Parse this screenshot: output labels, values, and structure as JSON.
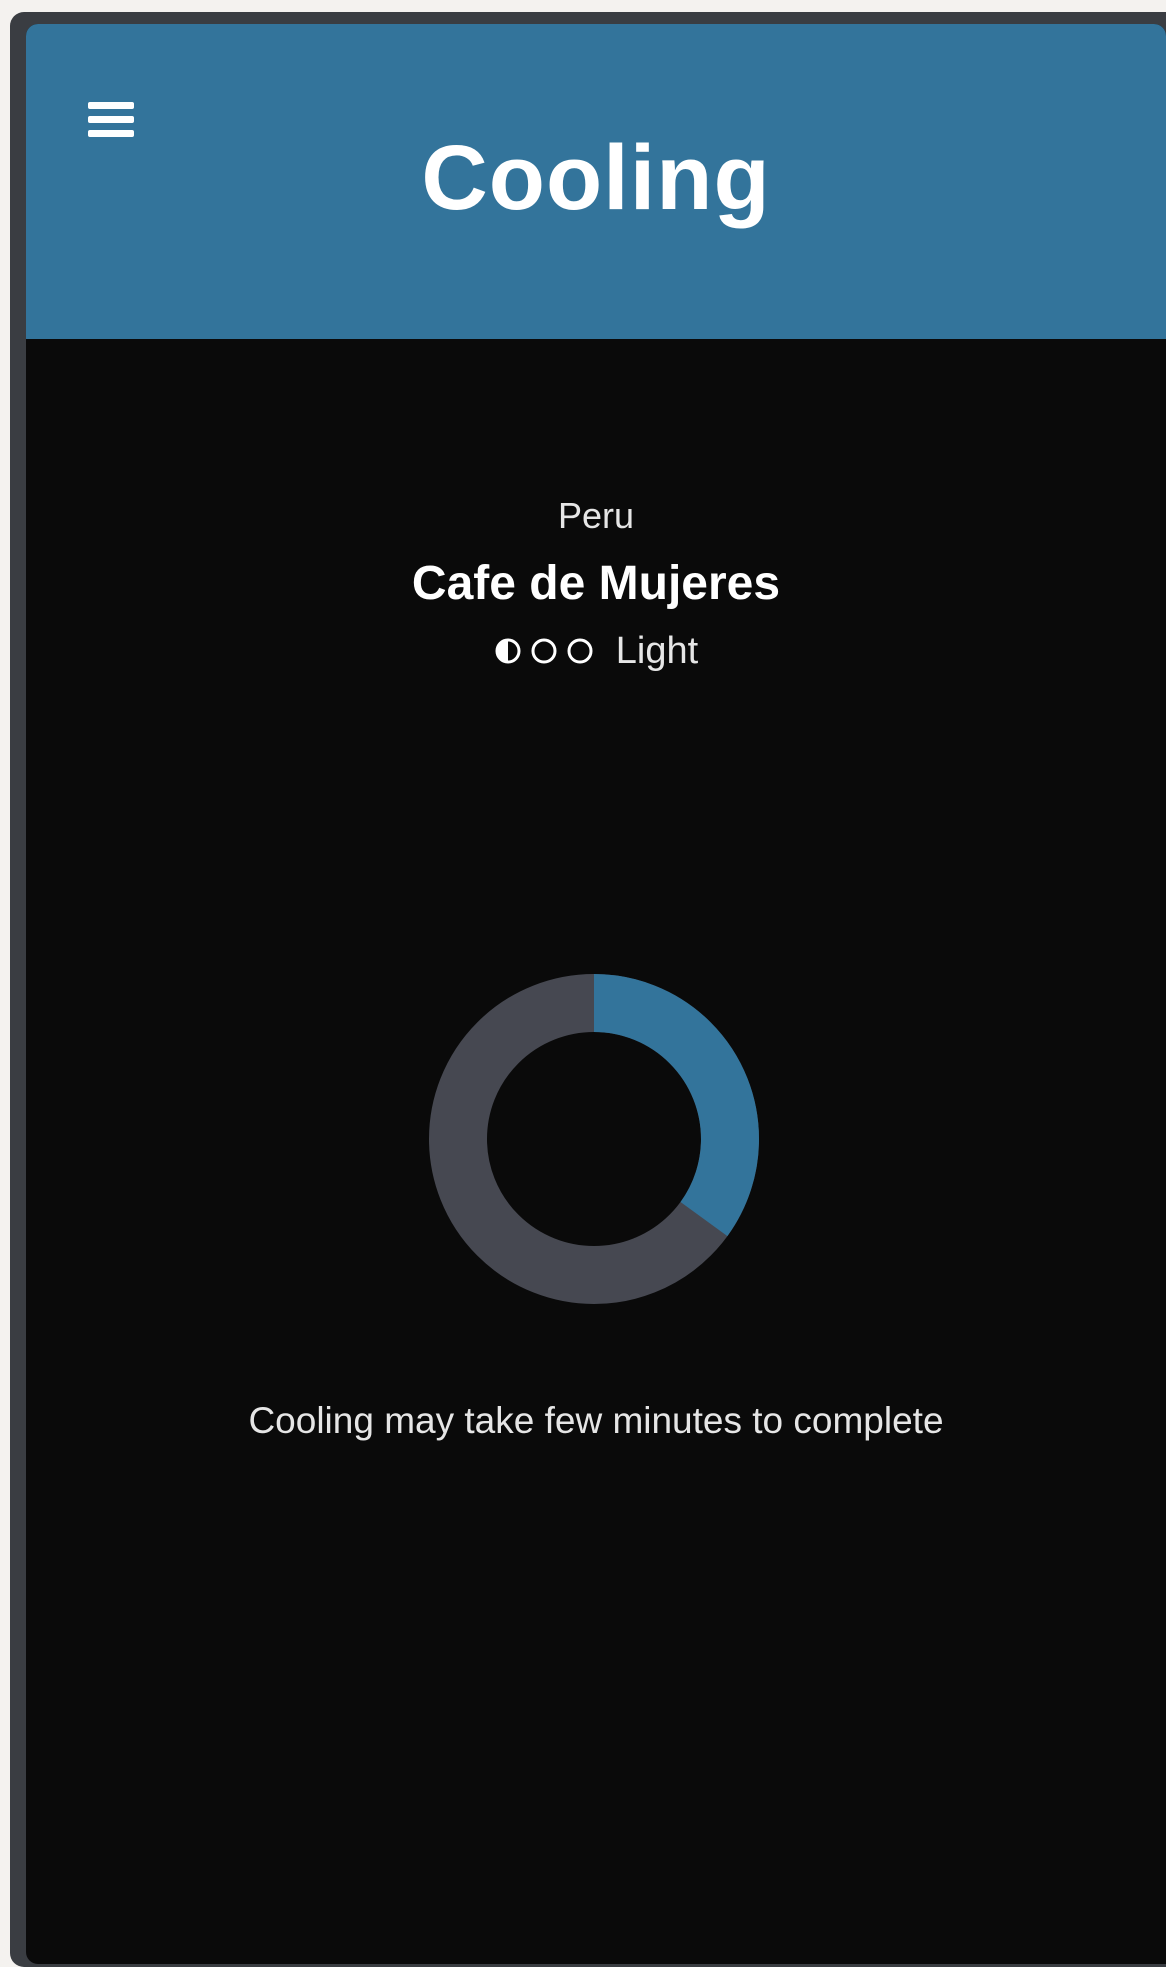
{
  "header": {
    "title": "Cooling",
    "menu_icon": "hamburger-menu-icon"
  },
  "coffee": {
    "origin": "Peru",
    "name": "Cafe de Mujeres",
    "roast_label": "Light",
    "roast_level_icons": [
      "half-filled-circle-icon",
      "empty-circle-icon",
      "empty-circle-icon"
    ]
  },
  "progress": {
    "fraction": 0.35
  },
  "message": "Cooling may take few minutes to complete",
  "colors": {
    "accent": "#33749b",
    "track": "#464851",
    "background": "#0a0a0a",
    "frame": "#3a3d42"
  }
}
